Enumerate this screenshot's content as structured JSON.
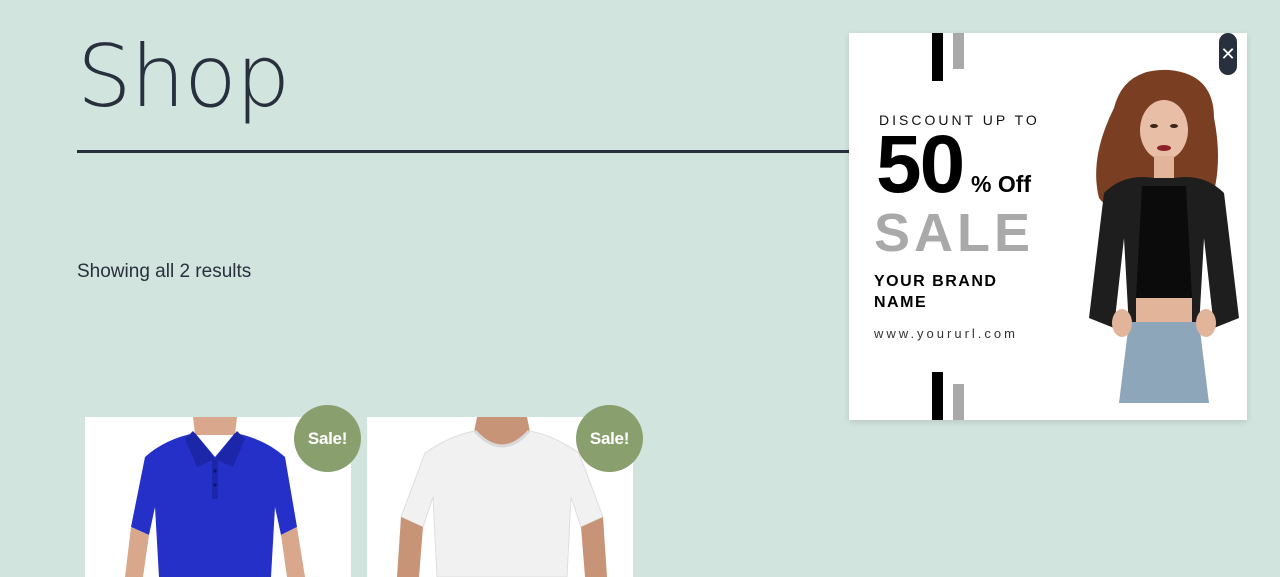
{
  "page": {
    "title": "Shop",
    "result_count": "Showing all 2 results"
  },
  "products": [
    {
      "badge": "Sale!",
      "image": "blue-polo-shirt"
    },
    {
      "badge": "Sale!",
      "image": "white-tshirt"
    }
  ],
  "popup": {
    "close_icon": "close-icon",
    "discount_label": "DISCOUNT UP TO",
    "discount_number": "50",
    "discount_suffix": "% Off",
    "sale_label": "SALE",
    "brand_name": "YOUR BRAND NAME",
    "url": "www.yoururl.com"
  },
  "colors": {
    "background": "#d2e4de",
    "text": "#28303d",
    "sale_badge": "#8a9f6e",
    "accent_gray": "#a9a9a9"
  }
}
